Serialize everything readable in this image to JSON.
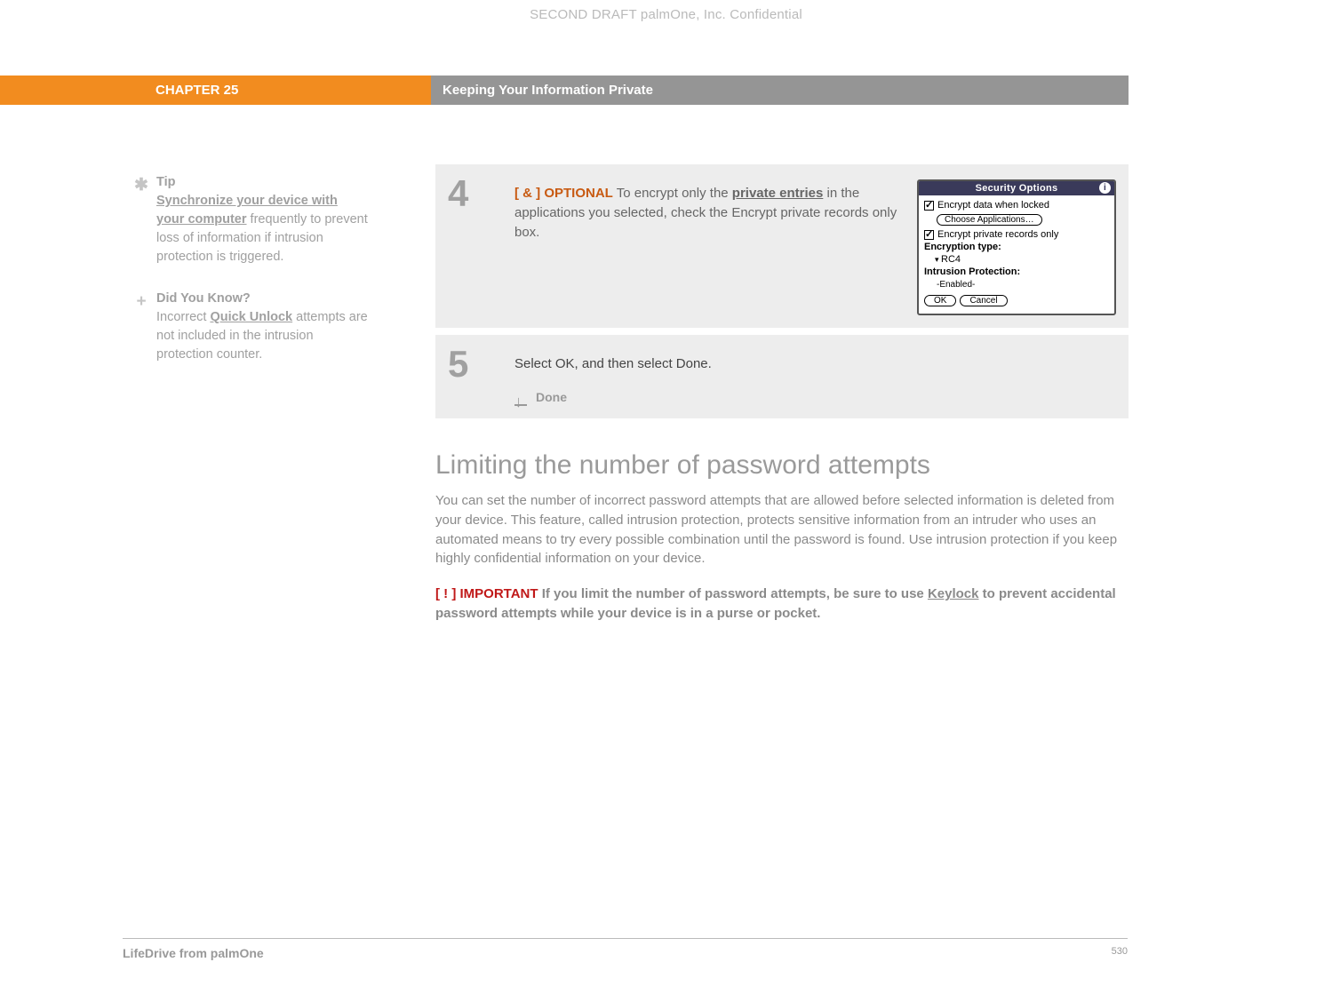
{
  "draft_header": "SECOND DRAFT palmOne, Inc.  Confidential",
  "chapter": {
    "label": "CHAPTER 25",
    "title": "Keeping Your Information Private"
  },
  "sidebar": {
    "tip": {
      "heading": "Tip",
      "link": "Synchronize your device with your computer",
      "rest": " frequently to prevent loss of information if intrusion protection is triggered."
    },
    "dyk": {
      "heading": "Did You Know?",
      "pre": "Incorrect ",
      "link": "Quick Unlock",
      "rest": " attempts are not included in the intrusion protection counter."
    }
  },
  "step4": {
    "num": "4",
    "tag": "[ & ]  OPTIONAL",
    "text_pre": "   To encrypt only the ",
    "link": "private entries",
    "text_post": " in the applications you selected, check the Encrypt private records only box."
  },
  "palm": {
    "title": "Security Options",
    "row1": "Encrypt data when locked",
    "choose": "Choose Applications…",
    "row2": "Encrypt private records only",
    "enc_label": "Encryption type:",
    "enc_value": "RC4",
    "intr_label": "Intrusion Protection:",
    "intr_value": "-Enabled-",
    "ok": "OK",
    "cancel": "Cancel"
  },
  "step5": {
    "num": "5",
    "text": "Select OK, and then select Done.",
    "done": "Done"
  },
  "section": {
    "heading": "Limiting the number of password attempts",
    "body": "You can set the number of incorrect password attempts that are allowed before selected information is deleted from your device. This feature, called intrusion protection, protects sensitive information from an intruder who uses an automated means to try every possible combination until the password is found. Use intrusion protection if you keep highly confidential information on your device.",
    "important_tag": "[ ! ] IMPORTANT",
    "important_pre": "  If you limit the number of password attempts, be sure to use ",
    "important_link": "Keylock",
    "important_post": " to prevent accidental password attempts while your device is in a purse or pocket."
  },
  "footer": {
    "product": "LifeDrive from palmOne",
    "page": "530"
  }
}
